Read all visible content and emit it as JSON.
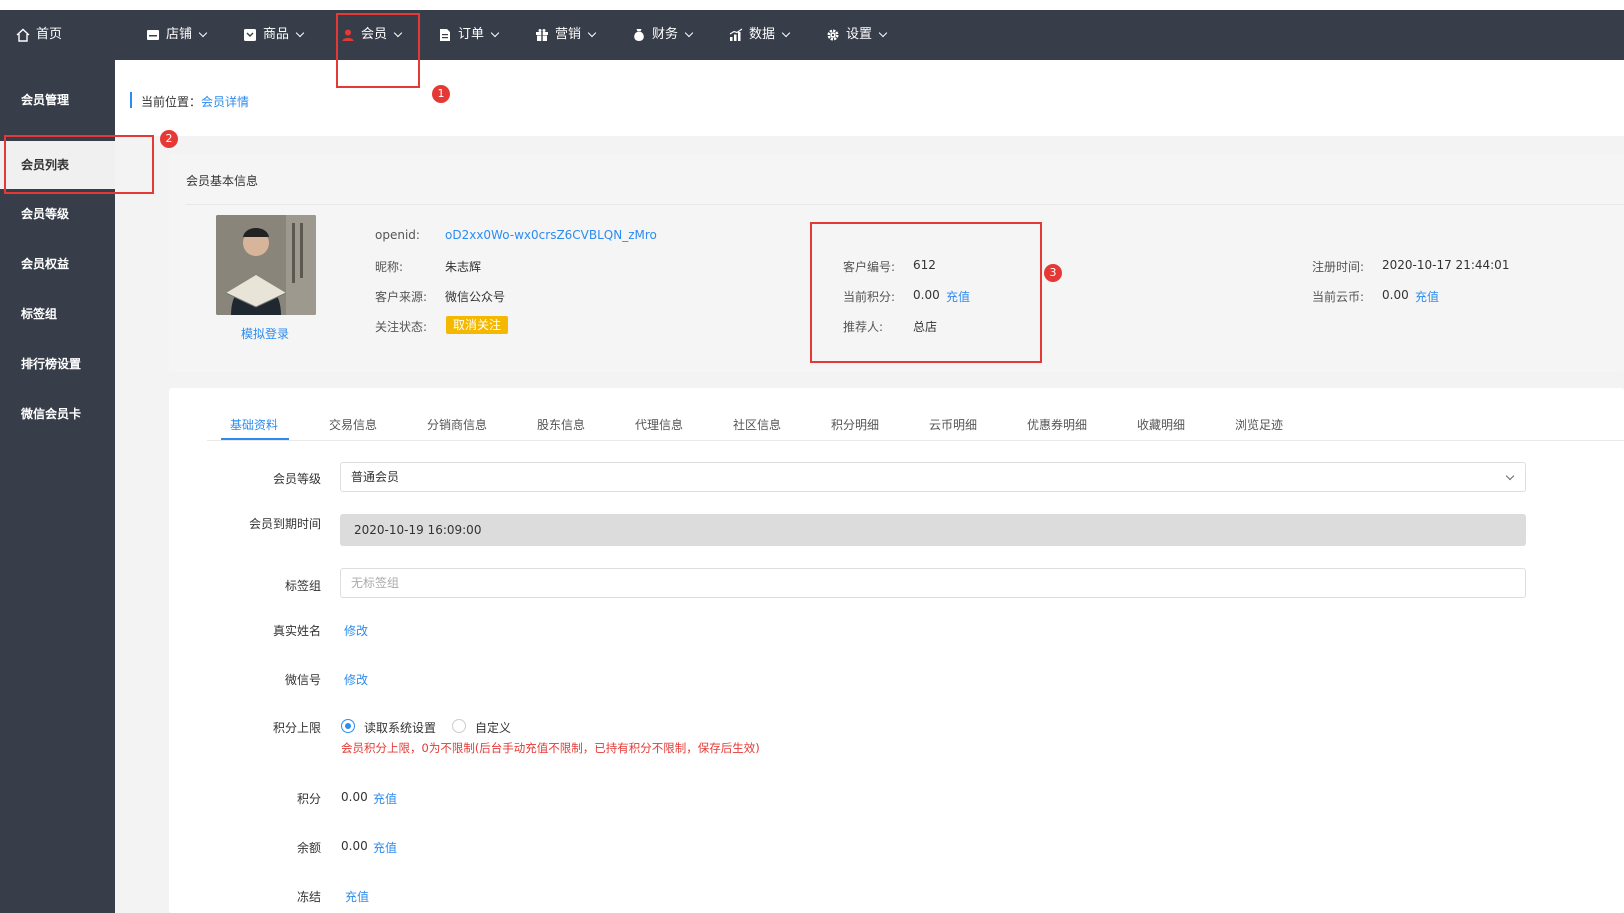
{
  "topnav": {
    "home": "首页",
    "items": [
      {
        "label": "店铺",
        "icon": "store-icon"
      },
      {
        "label": "商品",
        "icon": "goods-icon"
      },
      {
        "label": "会员",
        "icon": "user-icon"
      },
      {
        "label": "订单",
        "icon": "order-icon"
      },
      {
        "label": "营销",
        "icon": "gift-icon"
      },
      {
        "label": "财务",
        "icon": "money-bag-icon"
      },
      {
        "label": "数据",
        "icon": "chart-icon"
      },
      {
        "label": "设置",
        "icon": "gear-icon"
      }
    ]
  },
  "sidebar": {
    "items": [
      "会员管理",
      "会员列表",
      "会员等级",
      "会员权益",
      "标签组",
      "排行榜设置",
      "微信会员卡"
    ]
  },
  "breadcrumb": {
    "prefix": "当前位置：",
    "current": "会员详情"
  },
  "basic_info": {
    "title": "会员基本信息",
    "simulate_login": "模拟登录",
    "openid_label": "openid:",
    "openid": "oD2xx0Wo-wx0crsZ6CVBLQN_zMro",
    "nickname_label": "昵称:",
    "nickname": "朱志辉",
    "source_label": "客户来源:",
    "source": "微信公众号",
    "follow_label": "关注状态:",
    "follow_status": "取消关注",
    "customer_no_label": "客户编号:",
    "customer_no": "612",
    "points_label": "当前积分:",
    "points": "0.00",
    "recharge": "充值",
    "referrer_label": "推荐人:",
    "referrer": "总店",
    "reg_time_label": "注册时间:",
    "reg_time": "2020-10-17 21:44:01",
    "coins_label": "当前云币:",
    "coins": "0.00"
  },
  "annotations": [
    "1",
    "2",
    "3"
  ],
  "tabs": [
    "基础资料",
    "交易信息",
    "分销商信息",
    "股东信息",
    "代理信息",
    "社区信息",
    "积分明细",
    "云币明细",
    "优惠券明细",
    "收藏明细",
    "浏览足迹"
  ],
  "form": {
    "level_label": "会员等级",
    "level_value": "普通会员",
    "expire_label": "会员到期时间",
    "expire_value": "2020-10-19 16:09:00",
    "tag_label": "标签组",
    "tag_placeholder": "无标签组",
    "realname_label": "真实姓名",
    "edit": "修改",
    "wechat_label": "微信号",
    "points_limit_label": "积分上限",
    "radio_system": "读取系统设置",
    "radio_custom": "自定义",
    "points_limit_hint": "会员积分上限，0为不限制(后台手动充值不限制，已持有积分不限制，保存后生效)",
    "points_label": "积分",
    "points_value": "0.00",
    "balance_label": "余额",
    "balance_value": "0.00",
    "freeze_label": "冻结",
    "recharge": "充值"
  },
  "colors": {
    "topbar": "#373d49",
    "accent": "#2d8cf0",
    "badge": "#f5b800",
    "annotation": "#e53935"
  }
}
